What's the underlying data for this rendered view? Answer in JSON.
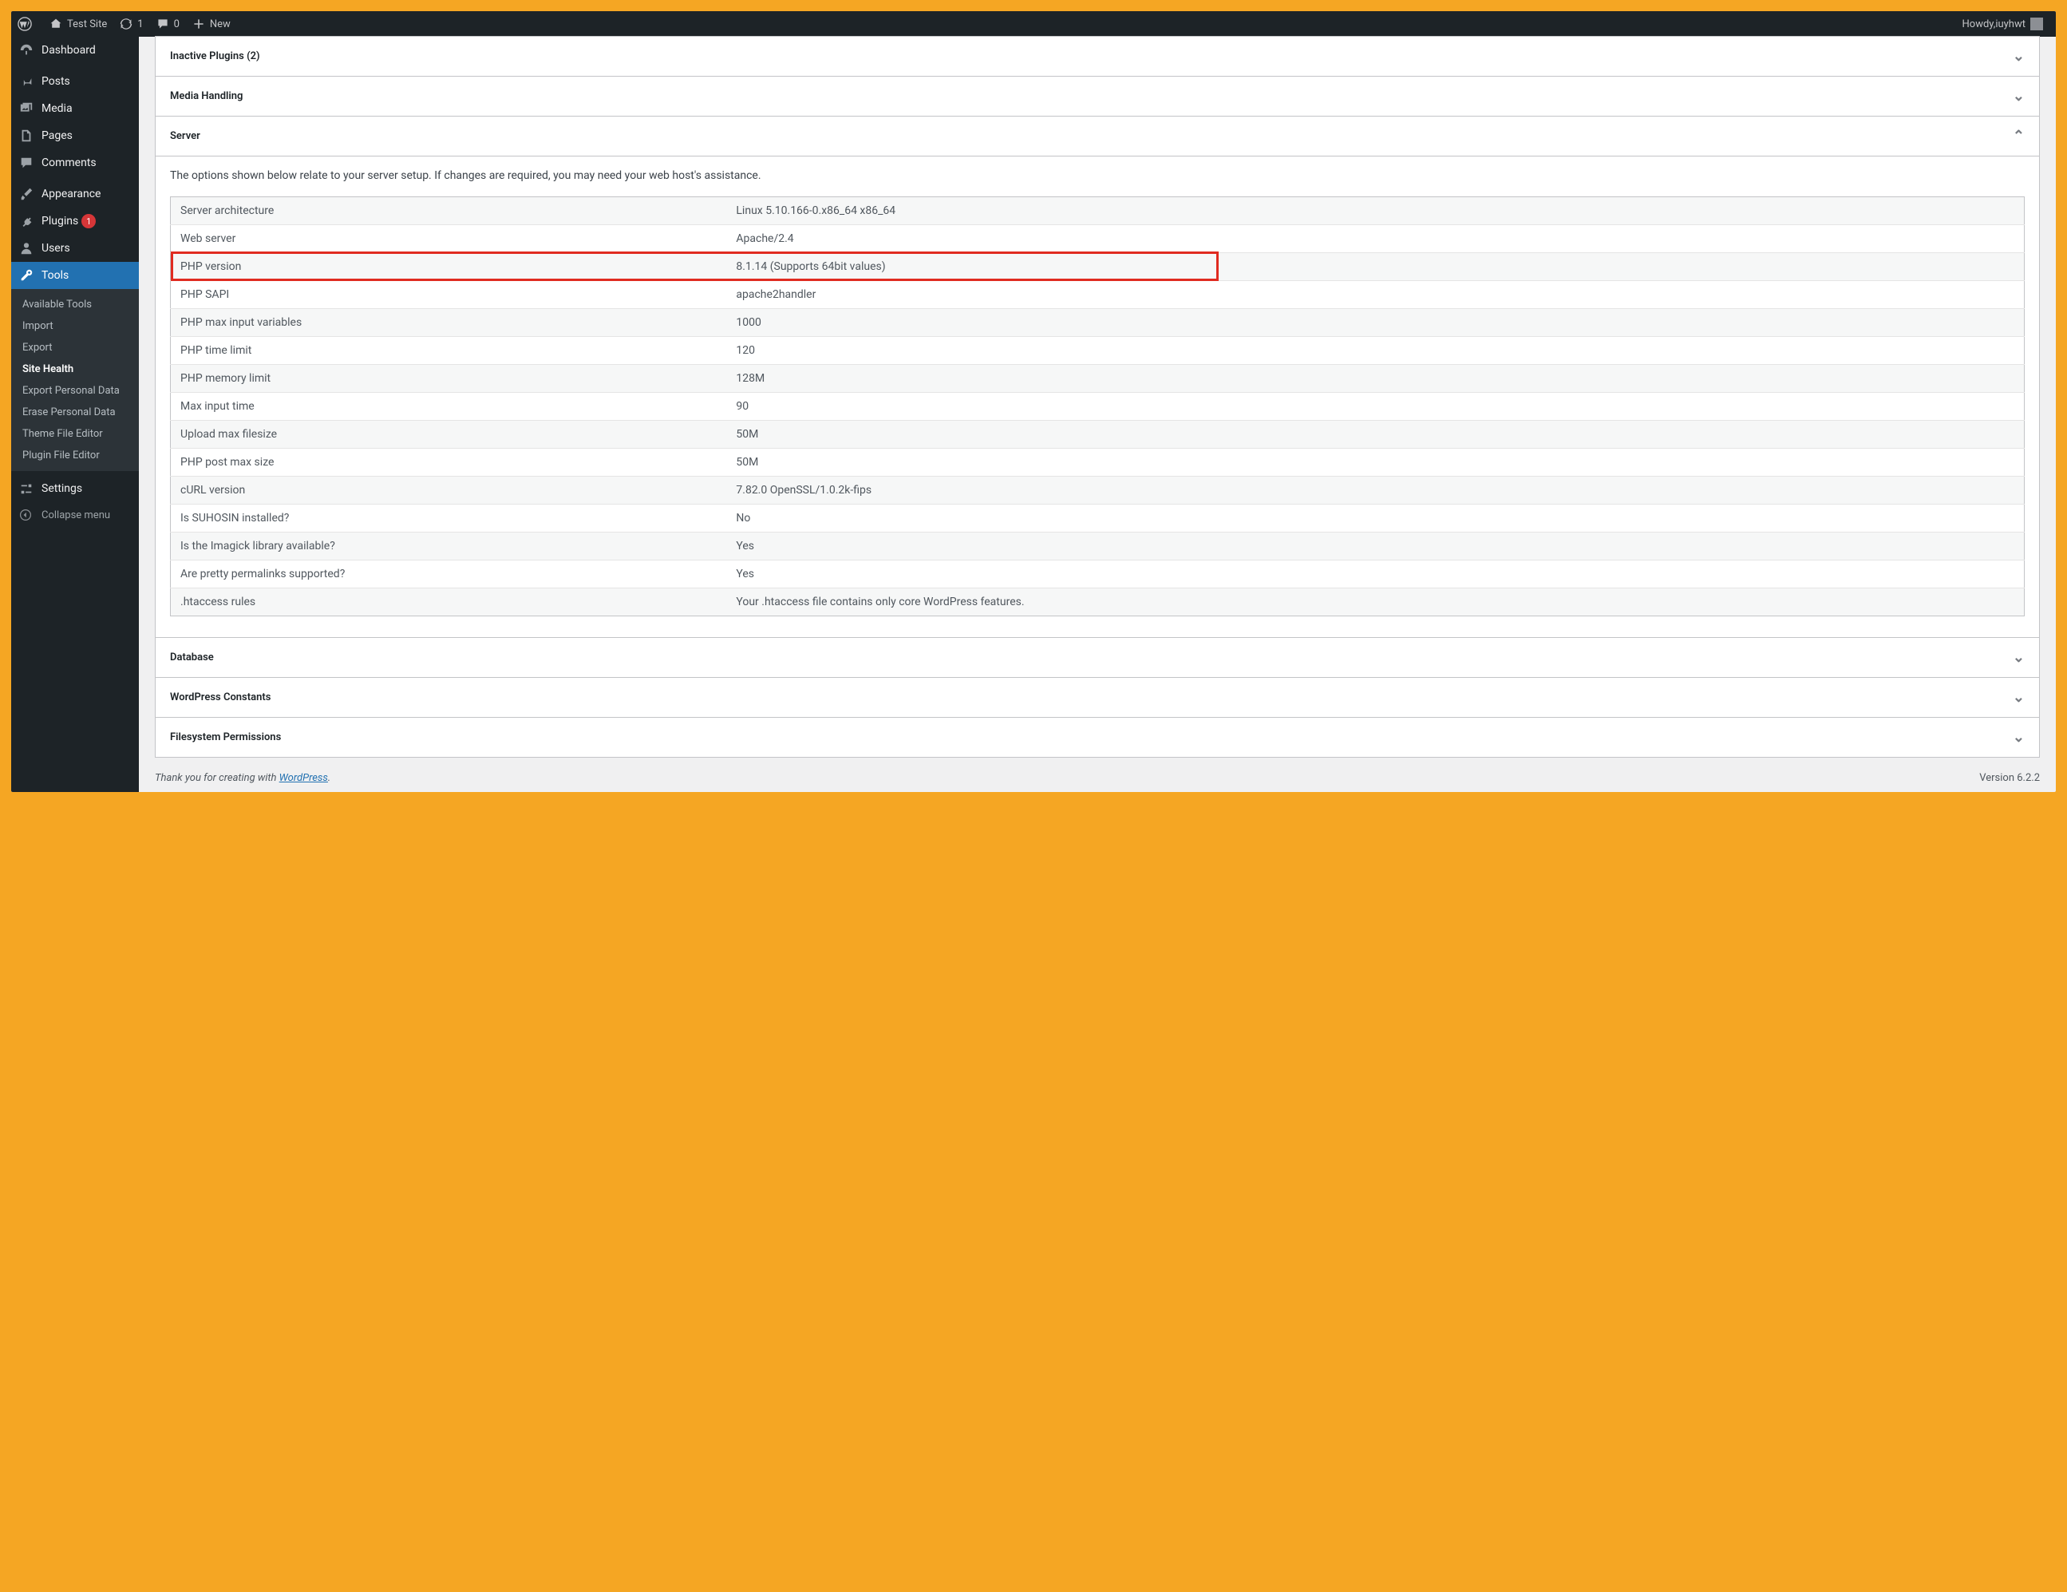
{
  "adminbar": {
    "site_name": "Test Site",
    "updates_count": "1",
    "comments_count": "0",
    "new_label": "New",
    "howdy_prefix": "Howdy, ",
    "user_name": "iuyhwt"
  },
  "sidebar": {
    "items": [
      {
        "id": "dashboard",
        "label": "Dashboard",
        "icon": "dashboard"
      },
      {
        "id": "posts",
        "label": "Posts",
        "icon": "pin"
      },
      {
        "id": "media",
        "label": "Media",
        "icon": "media"
      },
      {
        "id": "pages",
        "label": "Pages",
        "icon": "pages"
      },
      {
        "id": "comments",
        "label": "Comments",
        "icon": "comment"
      },
      {
        "id": "appearance",
        "label": "Appearance",
        "icon": "brush"
      },
      {
        "id": "plugins",
        "label": "Plugins",
        "icon": "plug",
        "badge": "1"
      },
      {
        "id": "users",
        "label": "Users",
        "icon": "user"
      },
      {
        "id": "tools",
        "label": "Tools",
        "icon": "wrench",
        "current": true
      },
      {
        "id": "settings",
        "label": "Settings",
        "icon": "sliders"
      }
    ],
    "tools_submenu": [
      {
        "id": "available-tools",
        "label": "Available Tools"
      },
      {
        "id": "import",
        "label": "Import"
      },
      {
        "id": "export",
        "label": "Export"
      },
      {
        "id": "site-health",
        "label": "Site Health",
        "current": true
      },
      {
        "id": "export-personal-data",
        "label": "Export Personal Data"
      },
      {
        "id": "erase-personal-data",
        "label": "Erase Personal Data"
      },
      {
        "id": "theme-file-editor",
        "label": "Theme File Editor"
      },
      {
        "id": "plugin-file-editor",
        "label": "Plugin File Editor"
      }
    ],
    "collapse_label": "Collapse menu"
  },
  "accordions": {
    "inactive_plugins": "Inactive Plugins (2)",
    "media_handling": "Media Handling",
    "server": "Server",
    "database": "Database",
    "wp_constants": "WordPress Constants",
    "fs_permissions": "Filesystem Permissions"
  },
  "server_section": {
    "description": "The options shown below relate to your server setup. If changes are required, you may need your web host's assistance.",
    "rows": [
      {
        "label": "Server architecture",
        "value": "Linux 5.10.166-0.x86_64 x86_64"
      },
      {
        "label": "Web server",
        "value": "Apache/2.4"
      },
      {
        "label": "PHP version",
        "value": "8.1.14 (Supports 64bit values)",
        "highlight": true
      },
      {
        "label": "PHP SAPI",
        "value": "apache2handler"
      },
      {
        "label": "PHP max input variables",
        "value": "1000"
      },
      {
        "label": "PHP time limit",
        "value": "120"
      },
      {
        "label": "PHP memory limit",
        "value": "128M"
      },
      {
        "label": "Max input time",
        "value": "90"
      },
      {
        "label": "Upload max filesize",
        "value": "50M"
      },
      {
        "label": "PHP post max size",
        "value": "50M"
      },
      {
        "label": "cURL version",
        "value": "7.82.0 OpenSSL/1.0.2k-fips"
      },
      {
        "label": "Is SUHOSIN installed?",
        "value": "No"
      },
      {
        "label": "Is the Imagick library available?",
        "value": "Yes"
      },
      {
        "label": "Are pretty permalinks supported?",
        "value": "Yes"
      },
      {
        "label": ".htaccess rules",
        "value": "Your .htaccess file contains only core WordPress features."
      }
    ]
  },
  "footer": {
    "thanks_prefix": "Thank you for creating with ",
    "wordpress_link": "WordPress",
    "thanks_suffix": ".",
    "version": "Version 6.2.2"
  }
}
